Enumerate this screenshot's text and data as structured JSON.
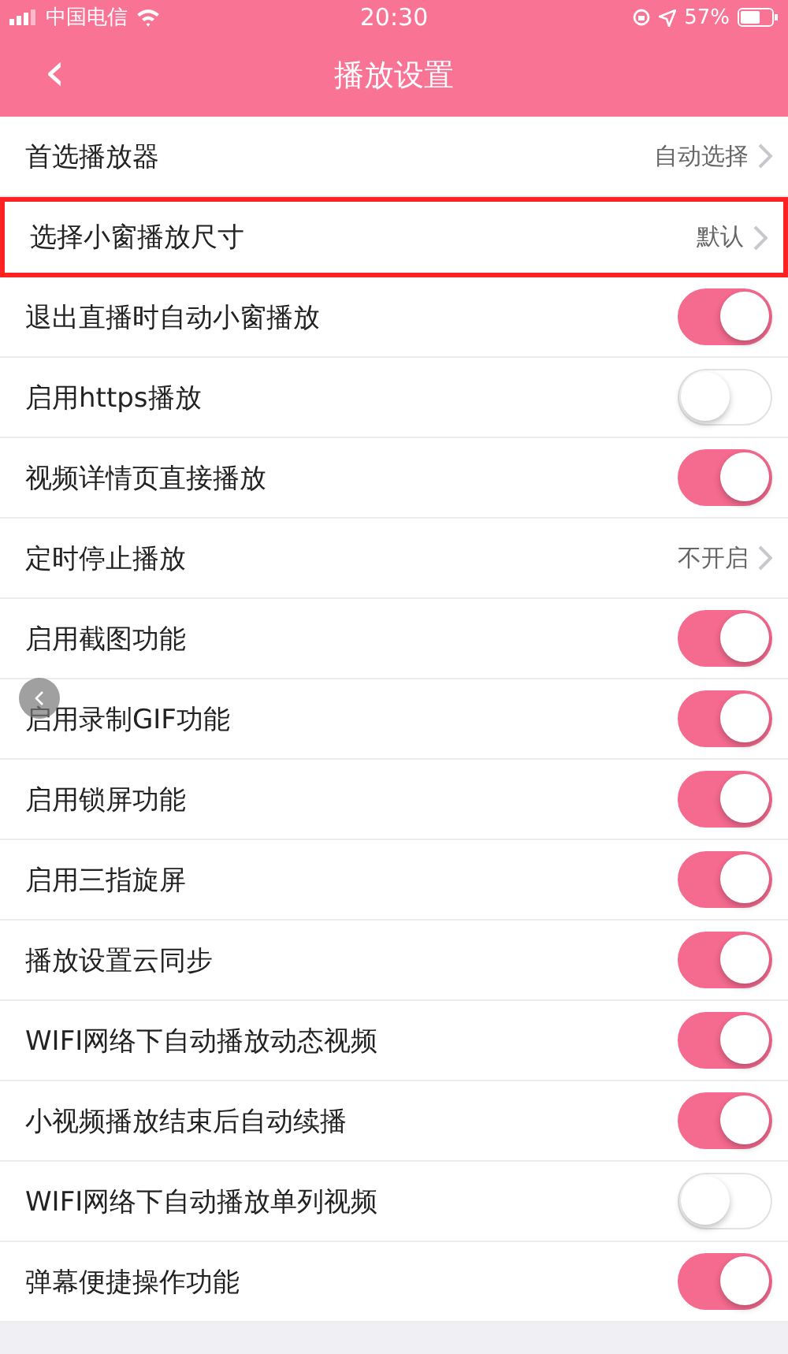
{
  "status_bar": {
    "carrier": "中国电信",
    "time": "20:30",
    "battery": "57%"
  },
  "nav": {
    "back": "‹",
    "title": "播放设置"
  },
  "rows": [
    {
      "kind": "link",
      "label": "首选播放器",
      "value": "自动选择",
      "highlighted": false
    },
    {
      "kind": "link",
      "label": "选择小窗播放尺寸",
      "value": "默认",
      "highlighted": true
    },
    {
      "kind": "toggle",
      "label": "退出直播时自动小窗播放",
      "on": true
    },
    {
      "kind": "toggle",
      "label": "启用https播放",
      "on": false
    },
    {
      "kind": "toggle",
      "label": "视频详情页直接播放",
      "on": true
    },
    {
      "kind": "link",
      "label": "定时停止播放",
      "value": "不开启",
      "highlighted": false
    },
    {
      "kind": "toggle",
      "label": "启用截图功能",
      "on": true
    },
    {
      "kind": "toggle",
      "label": "启用录制GIF功能",
      "on": true
    },
    {
      "kind": "toggle",
      "label": "启用锁屏功能",
      "on": true
    },
    {
      "kind": "toggle",
      "label": "启用三指旋屏",
      "on": true
    },
    {
      "kind": "toggle",
      "label": "播放设置云同步",
      "on": true
    },
    {
      "kind": "toggle",
      "label": "WIFI网络下自动播放动态视频",
      "on": true
    },
    {
      "kind": "toggle",
      "label": "小视频播放结束后自动续播",
      "on": true
    },
    {
      "kind": "toggle",
      "label": "WIFI网络下自动播放单列视频",
      "on": false
    },
    {
      "kind": "toggle",
      "label": "弹幕便捷操作功能",
      "on": true
    }
  ]
}
